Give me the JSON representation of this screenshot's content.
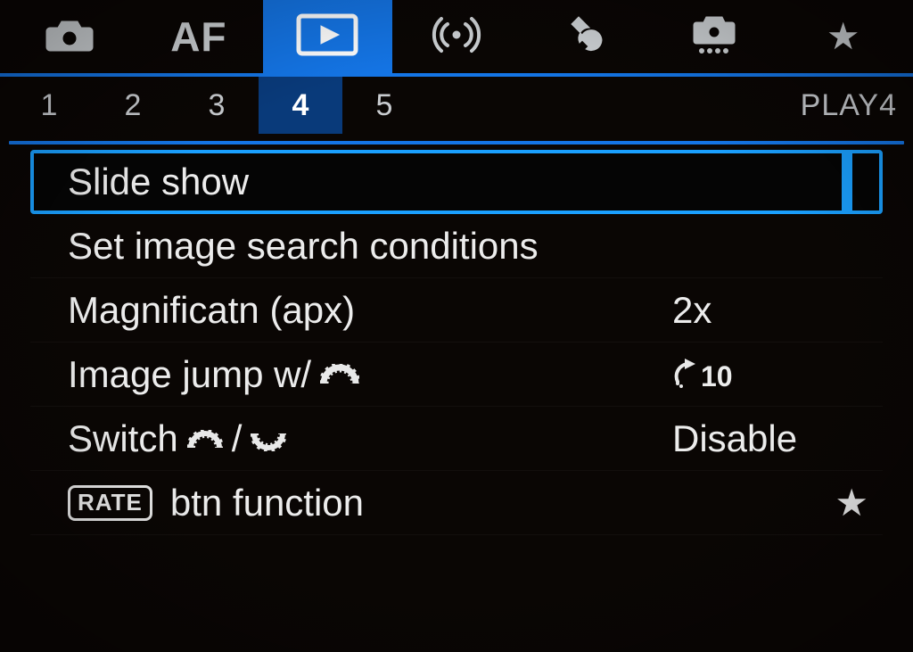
{
  "topTabs": {
    "af_label": "AF"
  },
  "pages": {
    "p1": "1",
    "p2": "2",
    "p3": "3",
    "p4": "4",
    "p5": "5",
    "label": "PLAY4"
  },
  "menu": {
    "slideShow": {
      "label": "Slide show"
    },
    "searchCond": {
      "label": "Set image search conditions"
    },
    "magnify": {
      "label": "Magnificatn (apx)",
      "value": "2x"
    },
    "imageJump": {
      "label_pre": "Image jump w/",
      "value_num": "10"
    },
    "switch": {
      "label_pre": "Switch ",
      "label_sep": "/",
      "value": "Disable"
    },
    "rateBtn": {
      "rate_box": "RATE",
      "label": " btn function"
    }
  }
}
